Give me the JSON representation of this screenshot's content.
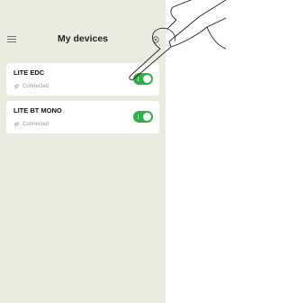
{
  "header": {
    "title": "My devices",
    "menu_icon": "hamburger-menu-icon",
    "settings_icon": "gear-icon"
  },
  "devices": [
    {
      "name": "LITE EDC",
      "status": "Connected",
      "enabled": true
    },
    {
      "name": "LITE BT MONO",
      "status": "Connected",
      "enabled": true
    }
  ],
  "colors": {
    "background": "#ecebe0",
    "card": "#ffffff",
    "toggle_on": "#2fb049"
  }
}
